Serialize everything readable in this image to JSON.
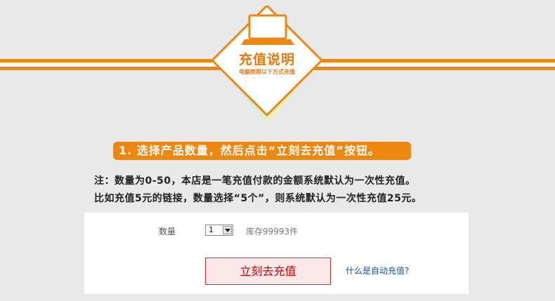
{
  "badge": {
    "title": "充值说明",
    "subtitle": "电脑按照以下方式充值",
    "icon": "laptop-icon",
    "color": "#ee8710"
  },
  "step": {
    "text": "1. 选择产品数量，然后点击“立刻去充值”按钮。"
  },
  "notes": {
    "line1": "注：数量为0-50，本店是一笔充值付款的金额系统默认为一次性充值。",
    "line2": "比如充值5元的链接，数量选择“5个”，则系统默认为一次性充值25元。"
  },
  "form": {
    "qty_label": "数量",
    "qty_value": "1",
    "stock_text": "库存99993件",
    "recharge_button": "立刻去充值",
    "help_link": "什么是自动充值?"
  }
}
